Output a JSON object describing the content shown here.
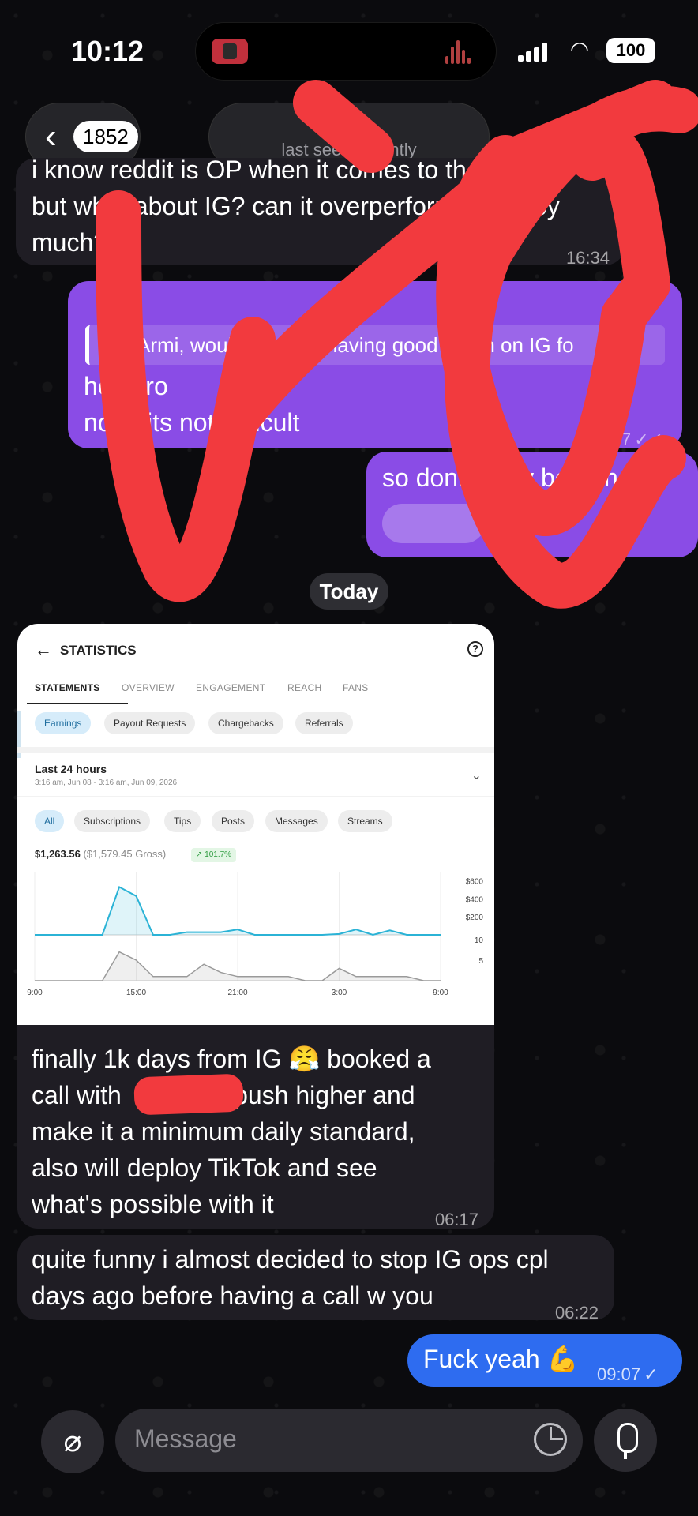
{
  "status": {
    "time": "10:12",
    "battery": "100"
  },
  "header": {
    "unread_count": "1852",
    "subtitle": "last seen recently"
  },
  "messages": {
    "m1": {
      "lines": [
        "i know reddit is OP when it comes to th...",
        "but what about IG? can it overperform reddit by",
        "much?"
      ],
      "time": "16:34"
    },
    "m2": {
      "quote": "Armi, would you say having good reach on IG fo",
      "lines": [
        "hey bro",
        "nope its not difficult"
      ],
      "time": "17:07"
    },
    "m3": {
      "lines": [
        "so dont worry bout that"
      ],
      "time": "17"
    },
    "date_chip": "Today",
    "m4": {
      "lines": [
        "finally 1k days from IG 😤 booked a",
        "call with            to push higher and",
        "make it a minimum daily standard,",
        "also will deploy TikTok and see",
        "what's possible with it"
      ],
      "time": "06:17"
    },
    "m5": {
      "lines": [
        "quite funny i almost decided to stop IG ops cpl",
        "days ago before having a call w you"
      ],
      "time": "06:22"
    },
    "m6": {
      "text": "Fuck yeah 💪",
      "time": "09:07"
    }
  },
  "composer": {
    "placeholder": "Message"
  },
  "stats_card": {
    "title": "STATISTICS",
    "tabs": [
      "STATEMENTS",
      "OVERVIEW",
      "ENGAGEMENT",
      "REACH",
      "FANS"
    ],
    "chips": [
      "Earnings",
      "Payout Requests",
      "Chargebacks",
      "Referrals"
    ],
    "range_title": "Last 24 hours",
    "range_sub": "3:16 am, Jun 08 - 3:16 am, Jun 09, 2026",
    "filters": [
      "All",
      "Subscriptions",
      "Tips",
      "Posts",
      "Messages",
      "Streams"
    ],
    "total": "$1,263.56",
    "gross": "($1,579.45 Gross)",
    "pct": "↗ 101.7%",
    "x_ticks": [
      "9:00",
      "15:00",
      "21:00",
      "3:00",
      "9:00"
    ],
    "y_ticks_top": [
      "$600",
      "$400",
      "$200"
    ],
    "y_ticks_bottom": [
      "10",
      "5"
    ],
    "colors": {
      "earnings_line": "#2bb3d6",
      "count_line": "#9a9a9a"
    }
  },
  "chart_data": {
    "type": "line",
    "x": [
      "9:00",
      "10:00",
      "11:00",
      "12:00",
      "13:00",
      "14:00",
      "15:00",
      "16:00",
      "17:00",
      "18:00",
      "19:00",
      "20:00",
      "21:00",
      "22:00",
      "23:00",
      "0:00",
      "1:00",
      "2:00",
      "3:00",
      "4:00",
      "5:00",
      "6:00",
      "7:00",
      "8:00",
      "9:00"
    ],
    "series": [
      {
        "values": [
          0,
          0,
          0,
          0,
          0,
          530,
          430,
          0,
          0,
          30,
          30,
          30,
          60,
          0,
          0,
          0,
          0,
          0,
          10,
          60,
          0,
          50,
          0,
          0,
          0
        ]
      },
      {
        "values": [
          0,
          0,
          0,
          0,
          0,
          7,
          5,
          1,
          1,
          1,
          4,
          2,
          1,
          1,
          1,
          1,
          0,
          0,
          3,
          1,
          1,
          1,
          1,
          0,
          0
        ]
      }
    ],
    "ylim": [
      0,
      700
    ]
  }
}
